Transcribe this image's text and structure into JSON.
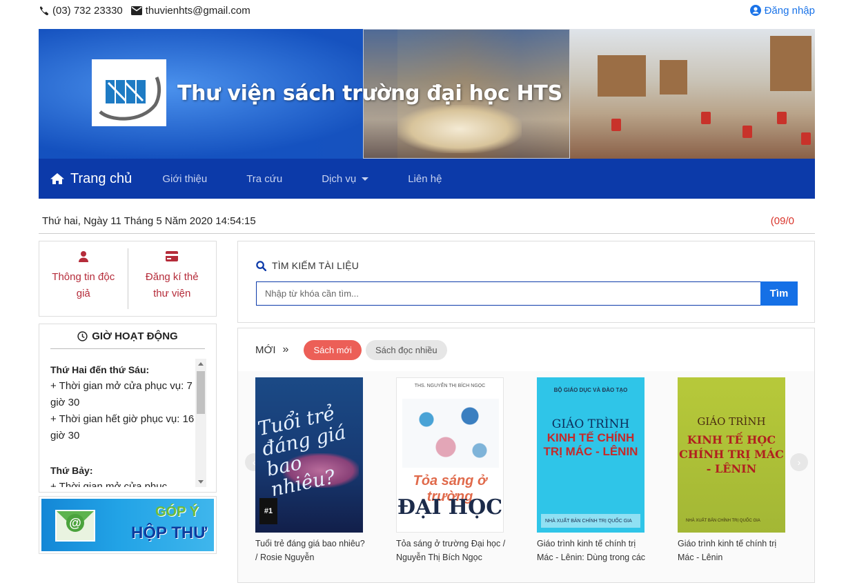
{
  "topbar": {
    "phone": "(03) 732 23330",
    "email": "thuvienhts@gmail.com",
    "login": "Đăng nhập",
    "icons": {
      "phone": "phone-icon",
      "email": "envelope-icon",
      "login": "user-circle-icon"
    }
  },
  "banner": {
    "title": "Thư viện sách trường đại học HTS"
  },
  "nav": {
    "home": "Trang chủ",
    "items": [
      "Giới thiệu",
      "Tra cứu",
      "Dịch vụ",
      "Liên hệ"
    ]
  },
  "datebar": {
    "datetime": "Thứ hai, Ngày 11 Tháng 5 Năm 2020 14:54:15",
    "ticker": "(09/0"
  },
  "quick": {
    "reader_info": "Thông tin độc giả",
    "register_card": "Đăng kí thẻ thư viện"
  },
  "hours": {
    "title": "GIỜ HOẠT ĐỘNG",
    "weekday_title": "Thứ Hai đến thứ Sáu:",
    "weekday_open": "+  Thời gian mở cửa phục vụ:  7 giờ 30",
    "weekday_close": "+  Thời gian hết giờ phục vụ:  16 giờ 30",
    "saturday_title": "Thứ Bảy:",
    "saturday_open": "+  Thời gian mở cửa phục"
  },
  "feedback": {
    "line1": "GÓP Ý",
    "line2": "HỘP THƯ",
    "at": "@"
  },
  "search": {
    "label": "TÌM KIẾM TÀI LIỆU",
    "placeholder": "Nhập từ khóa cần tìm...",
    "button": "Tìm"
  },
  "books": {
    "section": "MỚI",
    "tabs": [
      "Sách mới",
      "Sách đọc nhiều"
    ],
    "items": [
      {
        "caption": "Tuổi trẻ đáng giá bao nhiêu? / Rosie Nguyễn",
        "cover_title": "Tuổi trẻ đáng giá bao nhiêu?",
        "cover_badge": "#1"
      },
      {
        "caption": "Tỏa sáng ở trường Đại học / Nguyễn Thị Bích Ngọc",
        "cover_top": "THS. NGUYỄN THỊ BÍCH NGỌC",
        "cover_t1": "Tỏa sáng ở trường",
        "cover_t2": "ĐẠI HỌC"
      },
      {
        "caption": "Giáo trình kinh tế chính trị Mác - Lênin: Dùng trong các",
        "cover_top": "BỘ GIÁO DỤC VÀ ĐÀO TẠO",
        "cover_t1": "GIÁO TRÌNH",
        "cover_t2": "KINH TẾ CHÍNH TRỊ MÁC - LÊNIN",
        "cover_foot": "NHÀ XUẤT BẢN CHÍNH TRỊ QUỐC GIA"
      },
      {
        "caption": "Giáo trình kinh tế chính trị Mác - Lênin",
        "cover_t1": "GIÁO TRÌNH",
        "cover_t2": "KINH TẾ HỌC CHÍNH TRỊ MÁC - LÊNIN",
        "cover_foot": "NHÀ XUẤT BẢN CHÍNH TRỊ QUỐC GIA"
      }
    ]
  },
  "colors": {
    "nav_bg": "#0c3aa9",
    "accent_red": "#b52c3a",
    "pill_active": "#ec5f57",
    "search_btn": "#1570e6"
  }
}
